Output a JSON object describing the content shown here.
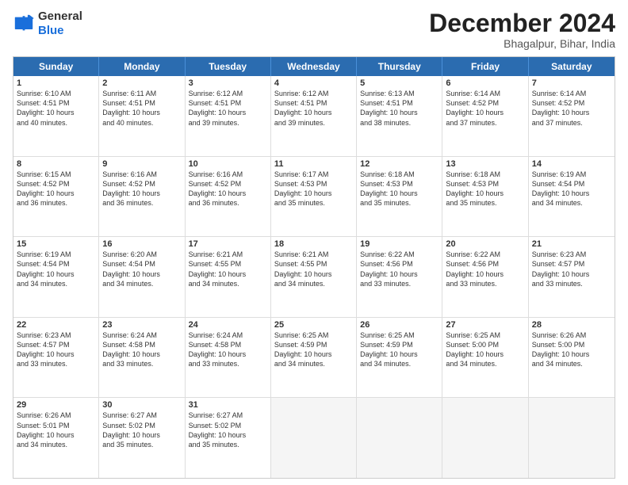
{
  "header": {
    "logo_general": "General",
    "logo_blue": "Blue",
    "month_title": "December 2024",
    "location": "Bhagalpur, Bihar, India"
  },
  "days_of_week": [
    "Sunday",
    "Monday",
    "Tuesday",
    "Wednesday",
    "Thursday",
    "Friday",
    "Saturday"
  ],
  "rows": [
    [
      {
        "day": "1",
        "info": "Sunrise: 6:10 AM\nSunset: 4:51 PM\nDaylight: 10 hours\nand 40 minutes."
      },
      {
        "day": "2",
        "info": "Sunrise: 6:11 AM\nSunset: 4:51 PM\nDaylight: 10 hours\nand 40 minutes."
      },
      {
        "day": "3",
        "info": "Sunrise: 6:12 AM\nSunset: 4:51 PM\nDaylight: 10 hours\nand 39 minutes."
      },
      {
        "day": "4",
        "info": "Sunrise: 6:12 AM\nSunset: 4:51 PM\nDaylight: 10 hours\nand 39 minutes."
      },
      {
        "day": "5",
        "info": "Sunrise: 6:13 AM\nSunset: 4:51 PM\nDaylight: 10 hours\nand 38 minutes."
      },
      {
        "day": "6",
        "info": "Sunrise: 6:14 AM\nSunset: 4:52 PM\nDaylight: 10 hours\nand 37 minutes."
      },
      {
        "day": "7",
        "info": "Sunrise: 6:14 AM\nSunset: 4:52 PM\nDaylight: 10 hours\nand 37 minutes."
      }
    ],
    [
      {
        "day": "8",
        "info": "Sunrise: 6:15 AM\nSunset: 4:52 PM\nDaylight: 10 hours\nand 36 minutes."
      },
      {
        "day": "9",
        "info": "Sunrise: 6:16 AM\nSunset: 4:52 PM\nDaylight: 10 hours\nand 36 minutes."
      },
      {
        "day": "10",
        "info": "Sunrise: 6:16 AM\nSunset: 4:52 PM\nDaylight: 10 hours\nand 36 minutes."
      },
      {
        "day": "11",
        "info": "Sunrise: 6:17 AM\nSunset: 4:53 PM\nDaylight: 10 hours\nand 35 minutes."
      },
      {
        "day": "12",
        "info": "Sunrise: 6:18 AM\nSunset: 4:53 PM\nDaylight: 10 hours\nand 35 minutes."
      },
      {
        "day": "13",
        "info": "Sunrise: 6:18 AM\nSunset: 4:53 PM\nDaylight: 10 hours\nand 35 minutes."
      },
      {
        "day": "14",
        "info": "Sunrise: 6:19 AM\nSunset: 4:54 PM\nDaylight: 10 hours\nand 34 minutes."
      }
    ],
    [
      {
        "day": "15",
        "info": "Sunrise: 6:19 AM\nSunset: 4:54 PM\nDaylight: 10 hours\nand 34 minutes."
      },
      {
        "day": "16",
        "info": "Sunrise: 6:20 AM\nSunset: 4:54 PM\nDaylight: 10 hours\nand 34 minutes."
      },
      {
        "day": "17",
        "info": "Sunrise: 6:21 AM\nSunset: 4:55 PM\nDaylight: 10 hours\nand 34 minutes."
      },
      {
        "day": "18",
        "info": "Sunrise: 6:21 AM\nSunset: 4:55 PM\nDaylight: 10 hours\nand 34 minutes."
      },
      {
        "day": "19",
        "info": "Sunrise: 6:22 AM\nSunset: 4:56 PM\nDaylight: 10 hours\nand 33 minutes."
      },
      {
        "day": "20",
        "info": "Sunrise: 6:22 AM\nSunset: 4:56 PM\nDaylight: 10 hours\nand 33 minutes."
      },
      {
        "day": "21",
        "info": "Sunrise: 6:23 AM\nSunset: 4:57 PM\nDaylight: 10 hours\nand 33 minutes."
      }
    ],
    [
      {
        "day": "22",
        "info": "Sunrise: 6:23 AM\nSunset: 4:57 PM\nDaylight: 10 hours\nand 33 minutes."
      },
      {
        "day": "23",
        "info": "Sunrise: 6:24 AM\nSunset: 4:58 PM\nDaylight: 10 hours\nand 33 minutes."
      },
      {
        "day": "24",
        "info": "Sunrise: 6:24 AM\nSunset: 4:58 PM\nDaylight: 10 hours\nand 33 minutes."
      },
      {
        "day": "25",
        "info": "Sunrise: 6:25 AM\nSunset: 4:59 PM\nDaylight: 10 hours\nand 34 minutes."
      },
      {
        "day": "26",
        "info": "Sunrise: 6:25 AM\nSunset: 4:59 PM\nDaylight: 10 hours\nand 34 minutes."
      },
      {
        "day": "27",
        "info": "Sunrise: 6:25 AM\nSunset: 5:00 PM\nDaylight: 10 hours\nand 34 minutes."
      },
      {
        "day": "28",
        "info": "Sunrise: 6:26 AM\nSunset: 5:00 PM\nDaylight: 10 hours\nand 34 minutes."
      }
    ],
    [
      {
        "day": "29",
        "info": "Sunrise: 6:26 AM\nSunset: 5:01 PM\nDaylight: 10 hours\nand 34 minutes."
      },
      {
        "day": "30",
        "info": "Sunrise: 6:27 AM\nSunset: 5:02 PM\nDaylight: 10 hours\nand 35 minutes."
      },
      {
        "day": "31",
        "info": "Sunrise: 6:27 AM\nSunset: 5:02 PM\nDaylight: 10 hours\nand 35 minutes."
      },
      {
        "day": "",
        "info": ""
      },
      {
        "day": "",
        "info": ""
      },
      {
        "day": "",
        "info": ""
      },
      {
        "day": "",
        "info": ""
      }
    ]
  ]
}
